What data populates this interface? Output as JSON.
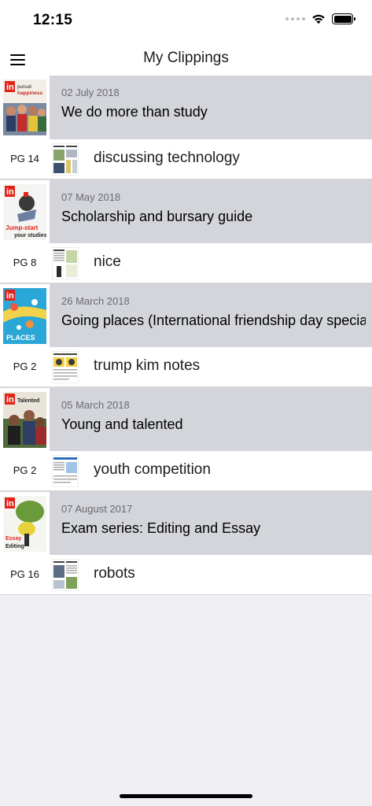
{
  "status_bar": {
    "time": "12:15"
  },
  "nav": {
    "title": "My Clippings",
    "menu_icon": "hamburger-menu-icon"
  },
  "clippings": [
    {
      "date": "02 July 2018",
      "title": "We do more than study",
      "cover_text": "In pursuit of happiness",
      "page": "PG 14",
      "label": "discussing technology"
    },
    {
      "date": "07 May 2018",
      "title": "Scholarship and bursary guide",
      "cover_text": "Jump-start your studies",
      "page": "PG 8",
      "label": "nice"
    },
    {
      "date": "26 March 2018",
      "title": "Going places (International friendship day special)",
      "cover_text": "PLACES",
      "page": "PG 2",
      "label": "trump kim notes"
    },
    {
      "date": "05 March 2018",
      "title": "Young and talented",
      "cover_text": "Talented",
      "page": "PG 2",
      "label": "youth competition"
    },
    {
      "date": "07 August 2017",
      "title": "Exam series: Editing and Essay",
      "cover_text": "Essay Editing",
      "page": "PG 16",
      "label": "robots"
    }
  ],
  "colors": {
    "issue_band": "#d3d5da",
    "background": "#efeff4",
    "brand_red": "#e2231a"
  }
}
